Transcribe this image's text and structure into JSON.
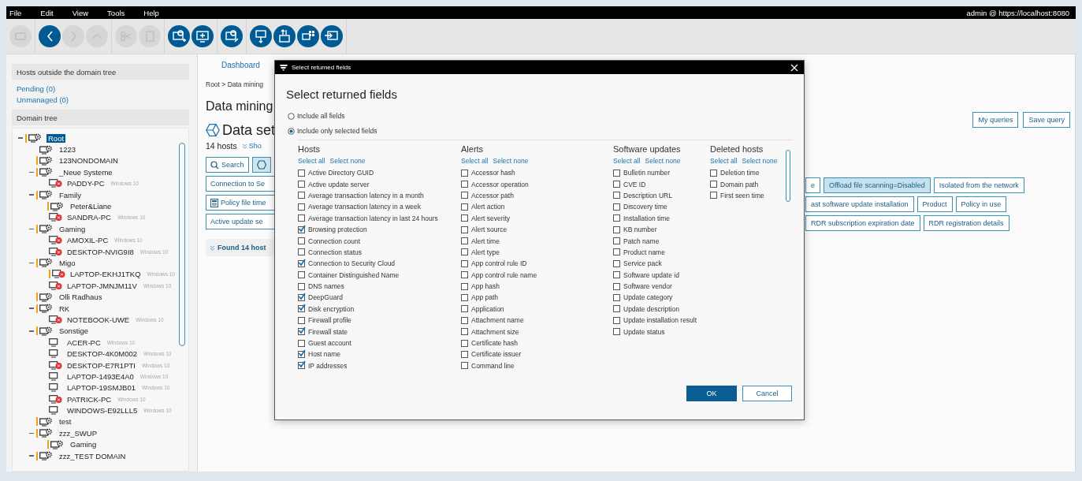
{
  "menu": [
    "File",
    "Edit",
    "View",
    "Tools",
    "Help"
  ],
  "user": "admin @ https://localhost:8080",
  "toolbar": {
    "groups": [
      {
        "buttons": [
          {
            "kind": "connect",
            "disabled": true
          }
        ]
      },
      {
        "buttons": [
          {
            "kind": "back",
            "disabled": false
          },
          {
            "kind": "forward",
            "disabled": true
          },
          {
            "kind": "up",
            "disabled": true
          }
        ]
      },
      {
        "buttons": [
          {
            "kind": "cut",
            "disabled": true
          },
          {
            "kind": "copy",
            "disabled": true
          }
        ]
      },
      {
        "buttons": [
          {
            "kind": "domain-add",
            "disabled": false
          },
          {
            "kind": "host-add",
            "disabled": false
          }
        ]
      },
      {
        "buttons": [
          {
            "kind": "domain-edit",
            "disabled": false
          }
        ]
      },
      {
        "buttons": [
          {
            "kind": "export",
            "disabled": false
          },
          {
            "kind": "import",
            "disabled": false
          },
          {
            "kind": "windows",
            "disabled": false
          },
          {
            "kind": "login",
            "disabled": false
          }
        ]
      }
    ]
  },
  "sidebar": {
    "outside_header": "Hosts outside the domain tree",
    "links": [
      "Pending (0)",
      "Unmanaged (0)"
    ],
    "tree_header": "Domain tree",
    "tree": [
      {
        "kind": "domain",
        "label": "Root",
        "marked": true,
        "expanded": true,
        "selected": true,
        "children": [
          {
            "kind": "domain",
            "label": "1223",
            "marked": false,
            "selected": false
          },
          {
            "kind": "domain",
            "label": "123NONDOMAIN",
            "marked": true,
            "selected": false
          },
          {
            "kind": "domain",
            "label": "_Neue Systeme",
            "marked": true,
            "expanded": true,
            "selected": false,
            "children": [
              {
                "kind": "host",
                "label": "PADDY-PC",
                "os": "Windows 10",
                "alert": true,
                "marked": false,
                "selected": false
              }
            ]
          },
          {
            "kind": "domain",
            "label": "Family",
            "marked": true,
            "expanded": true,
            "selected": false,
            "children": [
              {
                "kind": "domain",
                "label": "Peter&Liane",
                "marked": true,
                "selected": false
              },
              {
                "kind": "host",
                "label": "SANDRA-PC",
                "os": "Windows 10",
                "alert": true,
                "marked": false,
                "selected": false
              }
            ]
          },
          {
            "kind": "domain",
            "label": "Gaming",
            "marked": true,
            "expanded": true,
            "selected": false,
            "children": [
              {
                "kind": "host",
                "label": "AMOXIL-PC",
                "os": "Windows 10",
                "alert": true,
                "marked": false,
                "selected": false
              },
              {
                "kind": "host",
                "label": "DESKTOP-NVIG9I8",
                "os": "Windows 10",
                "alert": true,
                "marked": false,
                "selected": false
              }
            ]
          },
          {
            "kind": "domain",
            "label": "Migo",
            "marked": true,
            "expanded": true,
            "selected": false,
            "children": [
              {
                "kind": "host",
                "label": "LAPTOP-EKHJ1TKQ",
                "os": "Windows 10",
                "alert": true,
                "marked": true,
                "selected": false
              },
              {
                "kind": "host",
                "label": "LAPTOP-JMNJM11V",
                "os": "Windows 10",
                "alert": true,
                "marked": false,
                "selected": false
              }
            ]
          },
          {
            "kind": "domain",
            "label": "Olli Radhaus",
            "marked": true,
            "selected": false
          },
          {
            "kind": "domain",
            "label": "RK",
            "marked": true,
            "expanded": true,
            "selected": false,
            "children": [
              {
                "kind": "host",
                "label": "NOTEBOOK-UWE",
                "os": "Windows 10",
                "alert": true,
                "marked": false,
                "selected": false
              }
            ]
          },
          {
            "kind": "domain",
            "label": "Sonstige",
            "marked": true,
            "expanded": true,
            "selected": false,
            "children": [
              {
                "kind": "host",
                "label": "ACER-PC",
                "os": "Windows 10",
                "alert": false,
                "marked": false,
                "selected": false
              },
              {
                "kind": "host",
                "label": "DESKTOP-4K0M002",
                "os": "Windows 10",
                "alert": false,
                "marked": false,
                "selected": false
              },
              {
                "kind": "host",
                "label": "DESKTOP-E7R1PTI",
                "os": "Windows 10",
                "alert": true,
                "marked": false,
                "selected": false
              },
              {
                "kind": "host",
                "label": "LAPTOP-1493E4A0",
                "os": "Windows 10",
                "alert": false,
                "marked": false,
                "selected": false
              },
              {
                "kind": "host",
                "label": "LAPTOP-19SMJB01",
                "os": "Windows 10",
                "alert": false,
                "marked": false,
                "selected": false
              },
              {
                "kind": "host",
                "label": "PATRICK-PC",
                "os": "Windows 10",
                "alert": true,
                "marked": false,
                "selected": false
              },
              {
                "kind": "host",
                "label": "WINDOWS-E92LLL5",
                "os": "Windows 10",
                "alert": false,
                "marked": false,
                "selected": false
              }
            ]
          },
          {
            "kind": "domain",
            "label": "test",
            "marked": true,
            "selected": false
          },
          {
            "kind": "domain",
            "label": "zzz_SWUP",
            "marked": true,
            "expanded": true,
            "selected": false,
            "children": [
              {
                "kind": "domain",
                "label": "Gaming",
                "marked": true,
                "selected": false
              }
            ]
          },
          {
            "kind": "domain",
            "label": "zzz_TEST DOMAIN",
            "marked": true,
            "expanded": true,
            "selected": false
          }
        ]
      }
    ]
  },
  "main": {
    "tab": "Dashboard",
    "breadcrumb": "Root > Data mining",
    "heading": "Data mining",
    "dataset_title": "Data set",
    "hosts_count": "14 hosts",
    "show_link": "Sho",
    "search_button": "Search",
    "filter_buttons": [
      {
        "kind": "plain",
        "label": "Connection to Se"
      },
      {
        "kind": "calendar",
        "label": "Policy file time"
      },
      {
        "kind": "plain",
        "label": "Active update se"
      }
    ],
    "found": "Found 14 host",
    "query_buttons": [
      "My queries",
      "Save query"
    ],
    "chip_rows": [
      [
        {
          "label": "e",
          "selected": false
        },
        {
          "label": "Offload file scanning=Disabled",
          "selected": true
        },
        {
          "label": "Isolated from the network",
          "selected": false
        }
      ],
      [
        {
          "label": "ast software update installation",
          "selected": false
        },
        {
          "label": "Product",
          "selected": false
        },
        {
          "label": "Policy in use",
          "selected": false
        }
      ],
      [
        {
          "label": "RDR subscription expiration date",
          "selected": false
        },
        {
          "label": "RDR registration details",
          "selected": false
        }
      ]
    ]
  },
  "dialog": {
    "title": "Select returned fields",
    "heading": "Select returned fields",
    "options": [
      {
        "label": "Include all fields",
        "selected": false
      },
      {
        "label": "Include only selected fields",
        "selected": true
      }
    ],
    "columns": [
      {
        "title": "Hosts",
        "select_all": "Select all",
        "select_none": "Select none",
        "fields": [
          {
            "label": "Active Directory GUID",
            "checked": false
          },
          {
            "label": "Active update server",
            "checked": false
          },
          {
            "label": "Average transaction latency in a month",
            "checked": false
          },
          {
            "label": "Average transaction latency in a week",
            "checked": false
          },
          {
            "label": "Average transaction latency in last 24 hours",
            "checked": false
          },
          {
            "label": "Browsing protection",
            "checked": true
          },
          {
            "label": "Connection count",
            "checked": false
          },
          {
            "label": "Connection status",
            "checked": false
          },
          {
            "label": "Connection to Security Cloud",
            "checked": true
          },
          {
            "label": "Container Distinguished Name",
            "checked": false
          },
          {
            "label": "DNS names",
            "checked": false
          },
          {
            "label": "DeepGuard",
            "checked": true
          },
          {
            "label": "Disk encryption",
            "checked": true
          },
          {
            "label": "Firewall profile",
            "checked": false
          },
          {
            "label": "Firewall state",
            "checked": true
          },
          {
            "label": "Guest account",
            "checked": false
          },
          {
            "label": "Host name",
            "checked": true
          },
          {
            "label": "IP addresses",
            "checked": true
          }
        ]
      },
      {
        "title": "Alerts",
        "select_all": "Select all",
        "select_none": "Select none",
        "fields": [
          {
            "label": "Accessor hash",
            "checked": false
          },
          {
            "label": "Accessor operation",
            "checked": false
          },
          {
            "label": "Accessor path",
            "checked": false
          },
          {
            "label": "Alert action",
            "checked": false
          },
          {
            "label": "Alert severity",
            "checked": false
          },
          {
            "label": "Alert source",
            "checked": false
          },
          {
            "label": "Alert time",
            "checked": false
          },
          {
            "label": "Alert type",
            "checked": false
          },
          {
            "label": "App control rule ID",
            "checked": false
          },
          {
            "label": "App control rule name",
            "checked": false
          },
          {
            "label": "App hash",
            "checked": false
          },
          {
            "label": "App path",
            "checked": false
          },
          {
            "label": "Application",
            "checked": false
          },
          {
            "label": "Attachment name",
            "checked": false
          },
          {
            "label": "Attachment size",
            "checked": false
          },
          {
            "label": "Certificate hash",
            "checked": false
          },
          {
            "label": "Certificate issuer",
            "checked": false
          },
          {
            "label": "Command line",
            "checked": false
          }
        ]
      },
      {
        "title": "Software updates",
        "select_all": "Select all",
        "select_none": "Select none",
        "fields": [
          {
            "label": "Bulletin number",
            "checked": false
          },
          {
            "label": "CVE ID",
            "checked": false
          },
          {
            "label": "Description URL",
            "checked": false
          },
          {
            "label": "Discovery time",
            "checked": false
          },
          {
            "label": "Installation time",
            "checked": false
          },
          {
            "label": "KB number",
            "checked": false
          },
          {
            "label": "Patch name",
            "checked": false
          },
          {
            "label": "Product name",
            "checked": false
          },
          {
            "label": "Service pack",
            "checked": false
          },
          {
            "label": "Software update id",
            "checked": false
          },
          {
            "label": "Software vendor",
            "checked": false
          },
          {
            "label": "Update category",
            "checked": false
          },
          {
            "label": "Update description",
            "checked": false
          },
          {
            "label": "Update installation result",
            "checked": false
          },
          {
            "label": "Update status",
            "checked": false
          }
        ]
      },
      {
        "title": "Deleted hosts",
        "select_all": "Select all",
        "select_none": "Select none",
        "fields": [
          {
            "label": "Deletion time",
            "checked": false
          },
          {
            "label": "Domain path",
            "checked": false
          },
          {
            "label": "First seen time",
            "checked": false
          }
        ]
      }
    ],
    "ok": "OK",
    "cancel": "Cancel"
  }
}
